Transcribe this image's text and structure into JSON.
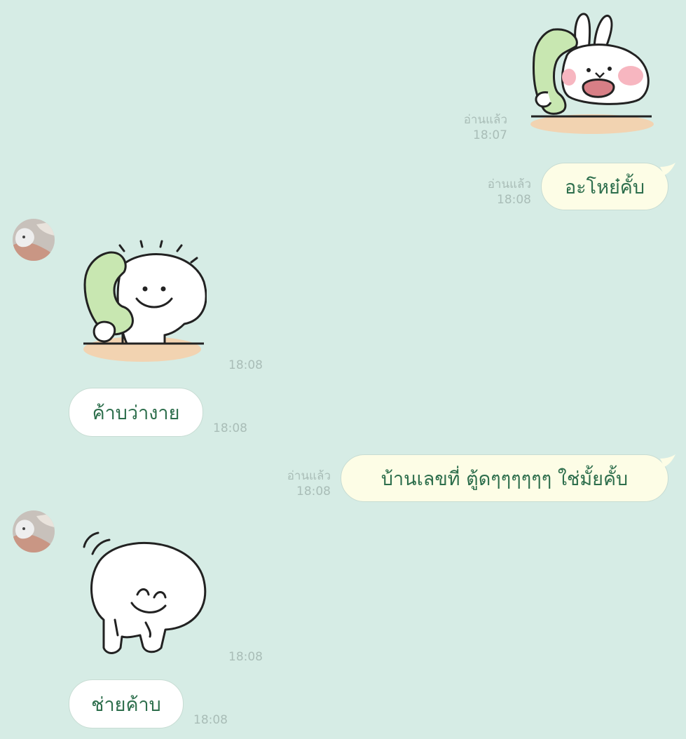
{
  "chat": {
    "messages": [
      {
        "id": "m1",
        "from": "me",
        "kind": "sticker",
        "sticker": "rabbit-phone-sticker",
        "read": "อ่านแล้ว",
        "time": "18:07"
      },
      {
        "id": "m2",
        "from": "me",
        "kind": "text",
        "text": "อะโหย๋คั้บ",
        "read": "อ่านแล้ว",
        "time": "18:08"
      },
      {
        "id": "m3",
        "from": "them",
        "kind": "sticker",
        "sticker": "blob-phone-sticker",
        "time": "18:08"
      },
      {
        "id": "m4",
        "from": "them",
        "kind": "text",
        "text": "ค้าบว่างาย",
        "time": "18:08"
      },
      {
        "id": "m5",
        "from": "me",
        "kind": "text",
        "text": "บ้านเลขที่ ตู้ดๆๆๆๆๆๆ ใช่มั้ยคั้บ",
        "read": "อ่านแล้ว",
        "time": "18:08"
      },
      {
        "id": "m6",
        "from": "them",
        "kind": "sticker",
        "sticker": "blob-bow-sticker",
        "time": "18:08"
      },
      {
        "id": "m7",
        "from": "them",
        "kind": "text",
        "text": "ช่ายค้าบ",
        "time": "18:08"
      }
    ]
  },
  "colors": {
    "background": "#d6ece5",
    "outgoing_bubble": "#fdfde6",
    "incoming_bubble": "#ffffff",
    "message_text": "#2d6e4c",
    "meta_text": "#a9bdb7"
  }
}
